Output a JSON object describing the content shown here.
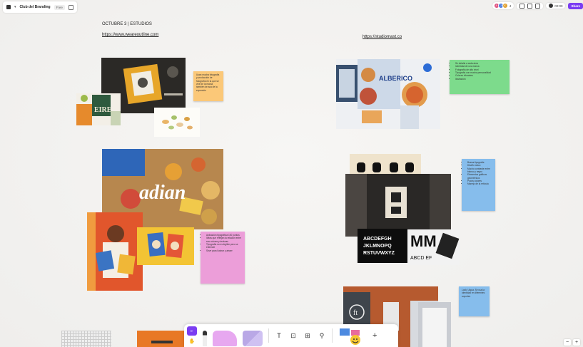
{
  "app": {
    "board_title": "Club del Branding",
    "plan_label": "Free"
  },
  "header_right": {
    "avatars": [
      "A",
      "J",
      "K"
    ],
    "avatar_count": "4",
    "timer": "00:00",
    "share_label": "Share"
  },
  "left_section": {
    "title": "OCTUBRE 3 | ESTUDIOS",
    "link": "https://www.weareoutline.com",
    "notes": [
      {
        "text": "Usan mucha fotografía y producción de fotografía en la que se vive de la marca también de acá de la expresión"
      },
      {
        "bullets": [
          "Aplicación tipográfica 100 puntos",
          "Ideas que reflejan la relación entre sus colores y texturas",
          "Tipografía no es legible pero se entiende",
          "Sirve para ilustrar y atraer"
        ]
      }
    ]
  },
  "right_section": {
    "link": "https://studiomast.co",
    "notes": [
      {
        "bullets": [
          "Se detalla a cada área",
          "Identidad de una marca",
          "Fotografía de alto nivel",
          "Tipografía con mucha personalidad",
          "Colores vibrantes",
          "Ilustración"
        ]
      },
      {
        "bullets": [
          "Buena tipografía",
          "Diseño único",
          "Mucho contraste entre blanco y negro",
          "Elementos gráficos geométricos",
          "Pocos colores",
          "Manejo de la retícula"
        ]
      },
      {
        "text": "Look / Aqua. Se usa la identidad en diferentes soportes"
      }
    ]
  },
  "toolbar": {
    "text_tool": "T",
    "plus": "+"
  },
  "zoom": {
    "out": "−",
    "in": "+"
  },
  "colors": {
    "accent": "#7b3df2",
    "orange_note": "#fbc878",
    "green_note": "#7ddb8c",
    "blue_note": "#86bdec",
    "pink_note": "#ec9ed9"
  }
}
